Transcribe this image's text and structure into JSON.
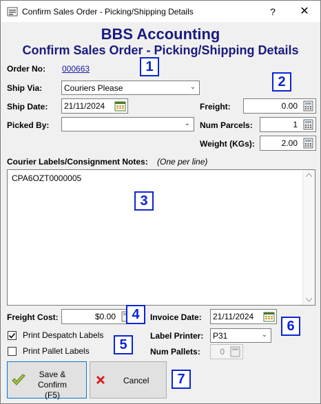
{
  "window": {
    "title": "Confirm Sales Order - Picking/Shipping Details",
    "help_glyph": "?",
    "close_glyph": "✕"
  },
  "header": {
    "company": "BBS Accounting",
    "subtitle": "Confirm Sales Order - Picking/Shipping Details"
  },
  "order": {
    "label": "Order No:",
    "value": "000663"
  },
  "ship_via": {
    "label": "Ship Via:",
    "value": "Couriers Please"
  },
  "ship_date": {
    "label": "Ship Date:",
    "value": "21/11/2024"
  },
  "picked_by": {
    "label": "Picked By:",
    "value": ""
  },
  "freight": {
    "label": "Freight:",
    "value": "0.00"
  },
  "num_parcels": {
    "label": "Num Parcels:",
    "value": "1"
  },
  "weight": {
    "label": "Weight (KGs):",
    "value": "2.00"
  },
  "courier": {
    "label": "Courier Labels/Consignment Notes:",
    "hint": "(One per line)",
    "lines": [
      "CPA6OZT0000005"
    ]
  },
  "freight_cost": {
    "label": "Freight Cost:",
    "value": "$0.00"
  },
  "invoice_date": {
    "label": "Invoice Date:",
    "value": "21/11/2024"
  },
  "print_despatch": {
    "label": "Print Despatch Labels",
    "checked": true
  },
  "print_pallet": {
    "label": "Print Pallet Labels",
    "checked": false
  },
  "label_printer": {
    "label": "Label Printer:",
    "value": "P31"
  },
  "num_pallets": {
    "label": "Num Pallets:",
    "value": "0"
  },
  "buttons": {
    "save": "Save & Confirm (F5)",
    "cancel": "Cancel"
  },
  "badges": [
    "1",
    "2",
    "3",
    "4",
    "5",
    "6",
    "7"
  ],
  "colors": {
    "accent": "#0b24d6",
    "heading": "#1a1a80",
    "link": "#1a1a9c"
  }
}
